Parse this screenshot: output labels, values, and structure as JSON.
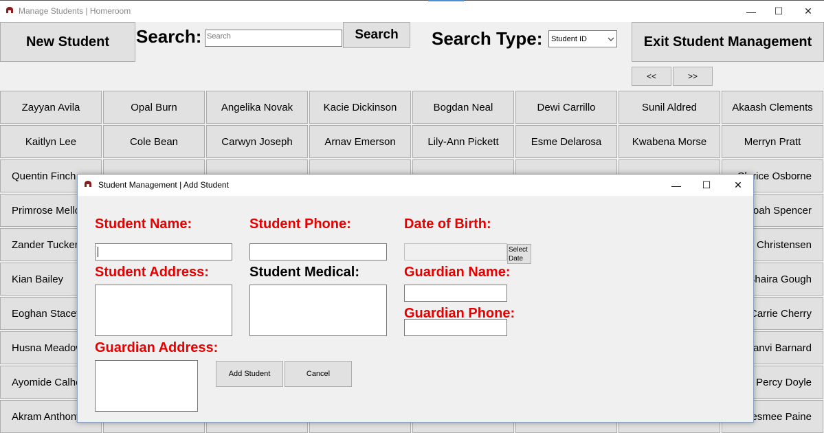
{
  "main_window": {
    "title": "Manage Students | Homeroom",
    "controls": {
      "minimize": "—",
      "maximize": "☐",
      "close": "✕"
    }
  },
  "toolbar": {
    "new_student": "New Student",
    "search_label": "Search:",
    "search_placeholder": "Search",
    "search_button": "Search",
    "search_type_label": "Search Type:",
    "search_type_value": "Student ID",
    "exit_button": "Exit Student Management",
    "prev_button": "<<",
    "next_button": ">>"
  },
  "students": [
    [
      "Zayyan Avila",
      "Opal Burn",
      "Angelika Novak",
      "Kacie Dickinson",
      "Bogdan Neal",
      "Dewi Carrillo",
      "Sunil Aldred",
      "Akaash Clements"
    ],
    [
      "Kaitlyn Lee",
      "Cole Bean",
      "Carwyn Joseph",
      "Arnav Emerson",
      "Lily-Ann Pickett",
      "Esme Delarosa",
      "Kwabena Morse",
      "Merryn Pratt"
    ],
    [
      "Quentin Finch",
      "",
      "",
      "",
      "",
      "",
      "",
      "Clarice Osborne"
    ],
    [
      "Primrose Mellor",
      "",
      "",
      "",
      "",
      "",
      "",
      "Noah Spencer"
    ],
    [
      "Zander Tucker",
      "",
      "",
      "",
      "",
      "",
      "",
      "Christensen"
    ],
    [
      "Kian Bailey",
      "",
      "",
      "",
      "",
      "",
      "",
      "Shaira Gough"
    ],
    [
      "Eoghan Stacey",
      "",
      "",
      "",
      "",
      "",
      "",
      "Carrie Cherry"
    ],
    [
      "Husna Meadows",
      "",
      "",
      "",
      "",
      "",
      "",
      "Janvi Barnard"
    ],
    [
      "Ayomide Calhoun",
      "",
      "",
      "",
      "",
      "",
      "",
      "Percy Doyle"
    ],
    [
      "Akram Anthony",
      "",
      "",
      "",
      "",
      "",
      "",
      "Desmee Paine"
    ]
  ],
  "dialog": {
    "title": "Student Management | Add Student",
    "labels": {
      "name": "Student Name:",
      "phone": "Student Phone:",
      "dob": "Date of Birth:",
      "address": "Student Address:",
      "medical": "Student Medical:",
      "guardian_name": "Guardian Name:",
      "guardian_phone": "Guardian Phone:",
      "guardian_address": "Guardian Address:"
    },
    "select_date": "Select Date",
    "add_button": "Add Student",
    "cancel_button": "Cancel"
  },
  "colors": {
    "required": "#e60000",
    "optional": "#000000"
  }
}
